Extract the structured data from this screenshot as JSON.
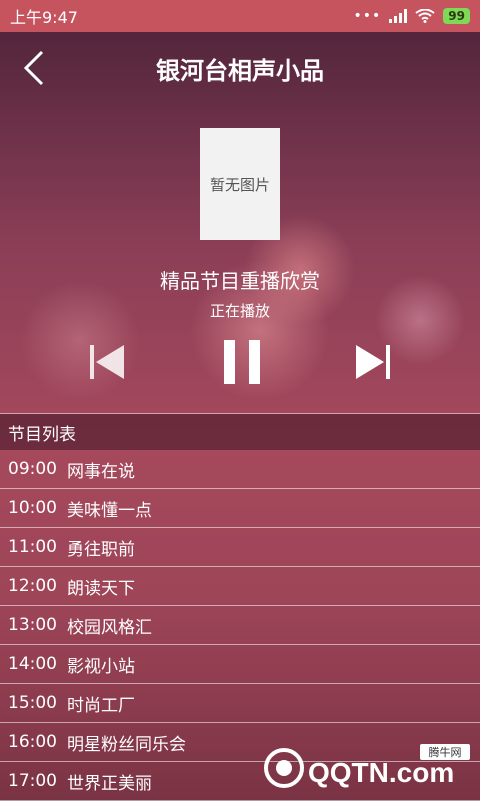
{
  "status_bar": {
    "time": "上午9:47",
    "battery": "99"
  },
  "header": {
    "title": "银河台相声小品"
  },
  "cover": {
    "placeholder": "暂无图片"
  },
  "player": {
    "program_title": "精品节目重播欣赏",
    "status": "正在播放"
  },
  "list": {
    "header": "节目列表",
    "items": [
      {
        "time": "09:00",
        "name": "网事在说"
      },
      {
        "time": "10:00",
        "name": "美味懂一点"
      },
      {
        "time": "11:00",
        "name": "勇往职前"
      },
      {
        "time": "12:00",
        "name": "朗读天下"
      },
      {
        "time": "13:00",
        "name": "校园风格汇"
      },
      {
        "time": "14:00",
        "name": "影视小站"
      },
      {
        "time": "15:00",
        "name": "时尚工厂"
      },
      {
        "time": "16:00",
        "name": "明星粉丝同乐会"
      },
      {
        "time": "17:00",
        "name": "世界正美丽"
      }
    ]
  },
  "watermark": {
    "brand": "QQTN.com",
    "site": "腾牛网"
  }
}
